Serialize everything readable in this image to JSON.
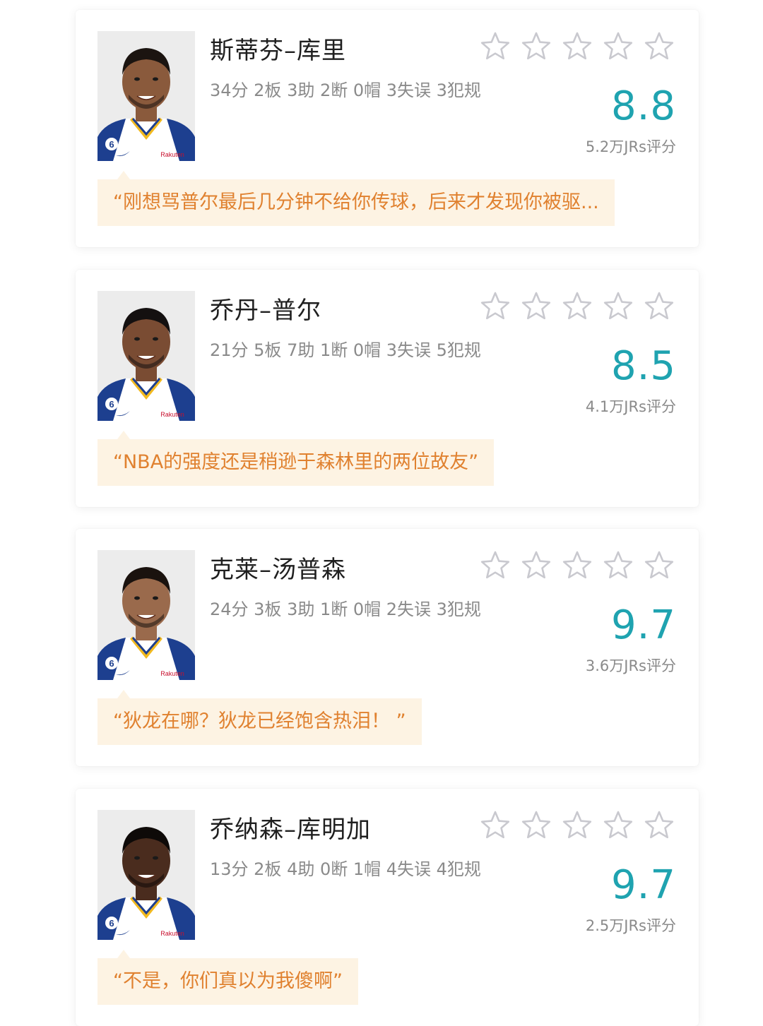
{
  "colors": {
    "accent": "#1fa3b0",
    "quote_text": "#e0812f",
    "quote_bg": "#fdf3e3",
    "star_outline": "#c9c9cf"
  },
  "players": [
    {
      "name": "斯蒂芬–库里",
      "stats": "34分 2板 3助 2断 0帽 3失误 3犯规",
      "score": "8.8",
      "votes": "5.2万JRs评分",
      "comment": "“刚想骂普尔最后几分钟不给你传球，后来才发现你被驱...",
      "rating_stars_filled": 0,
      "jersey_number": "6",
      "sponsor": "Rakuten"
    },
    {
      "name": "乔丹–普尔",
      "stats": "21分 5板 7助 1断 0帽 3失误 5犯规",
      "score": "8.5",
      "votes": "4.1万JRs评分",
      "comment": "“NBA的强度还是稍逊于森林里的两位故友”",
      "rating_stars_filled": 0,
      "jersey_number": "6",
      "sponsor": "Rakuten"
    },
    {
      "name": "克莱–汤普森",
      "stats": "24分 3板 3助 1断 0帽 2失误 3犯规",
      "score": "9.7",
      "votes": "3.6万JRs评分",
      "comment": "“狄龙在哪？狄龙已经饱含热泪！ ”",
      "rating_stars_filled": 0,
      "jersey_number": "6",
      "sponsor": "Rakuten"
    },
    {
      "name": "乔纳森–库明加",
      "stats": "13分 2板 4助 0断 1帽 4失误 4犯规",
      "score": "9.7",
      "votes": "2.5万JRs评分",
      "comment": "“不是，你们真以为我傻啊”",
      "rating_stars_filled": 0,
      "jersey_number": "6",
      "sponsor": "Rakuten"
    }
  ]
}
